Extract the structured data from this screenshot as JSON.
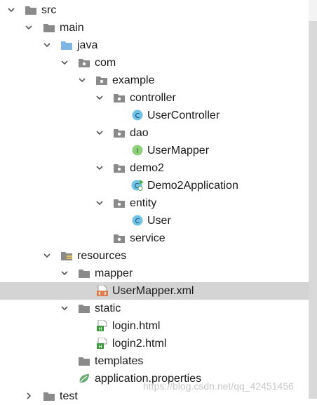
{
  "tree": {
    "items": [
      {
        "label": "src"
      },
      {
        "label": "main"
      },
      {
        "label": "java"
      },
      {
        "label": "com"
      },
      {
        "label": "example"
      },
      {
        "label": "controller"
      },
      {
        "label": "UserController",
        "badge": "C"
      },
      {
        "label": "dao"
      },
      {
        "label": "UserMapper",
        "badge": "I"
      },
      {
        "label": "demo2"
      },
      {
        "label": "Demo2Application",
        "badge": "C"
      },
      {
        "label": "entity"
      },
      {
        "label": "User",
        "badge": "C"
      },
      {
        "label": "service"
      },
      {
        "label": "resources"
      },
      {
        "label": "mapper"
      },
      {
        "label": "UserMapper.xml"
      },
      {
        "label": "static"
      },
      {
        "label": "login.html",
        "badge": "H"
      },
      {
        "label": "login2.html",
        "badge": "H"
      },
      {
        "label": "templates"
      },
      {
        "label": "application.properties"
      },
      {
        "label": "test"
      }
    ],
    "selected_item": "UserMapper.xml"
  },
  "watermark": "https://blog.csdn.net/qq_42451456",
  "colors": {
    "folder": "#8a8a8a",
    "source_folder": "#7fb4e6",
    "class_badge": "#6ec3e6",
    "interface_badge": "#8fd17a",
    "html_badge": "#3c9a3c",
    "xml": "#e07a4f",
    "spring_leaf": "#6aab73",
    "run_marker": "#4caf50",
    "selection": "#d4d4d4"
  }
}
